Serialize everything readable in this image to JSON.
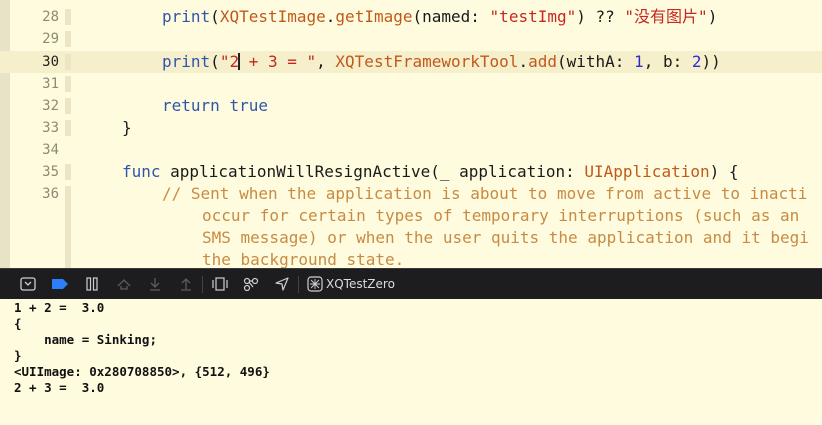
{
  "editor": {
    "lines": [
      {
        "num": "28"
      },
      {
        "num": "29"
      },
      {
        "num": "30"
      },
      {
        "num": "31"
      },
      {
        "num": "32"
      },
      {
        "num": "33"
      },
      {
        "num": "34"
      },
      {
        "num": "35"
      },
      {
        "num": "36"
      }
    ],
    "t": {
      "print": "print",
      "paren_open": "(",
      "xqtestimage": "XQTestImage",
      "dot": ".",
      "getimage": "getImage",
      "named_label": "(named: ",
      "test_img": "\"testImg\"",
      "coalesce": ") ?? ",
      "no_image": "\"没有图片\"",
      "paren_close": ")",
      "str_part1": "\"2",
      "str_part2": " + 3 = \"",
      "comma": ", ",
      "framework_tool": "XQTestFrameworkTool",
      "add": "add",
      "with_a": "(withA: ",
      "num_1": "1",
      "b_label": ", b: ",
      "num_2": "2",
      "close_two": "))",
      "return_kw": "return",
      "true_kw": "true",
      "brace_close": "}",
      "func_kw": "func",
      "func_name": " applicationWillResignActive(_ application: ",
      "uiapplication": "UIApplication",
      "func_tail": ") {",
      "comment_1": "// Sent when the application is about to move from active to inacti",
      "comment_2": "occur for certain types of temporary interruptions (such as an",
      "comment_3": "SMS message) or when the user quits the application and it begi",
      "comment_4": "the background state."
    }
  },
  "debug_bar": {
    "target": "XQTestZero"
  },
  "console": {
    "output": [
      "1 + 2 =  3.0",
      "{",
      "    name = Sinking;",
      "}",
      "<UIImage: 0x280708850>, {512, 496}",
      "2 + 3 =  3.0"
    ]
  },
  "colors": {
    "editor_bg": "#fffbdf",
    "current_line": "#f5efcb",
    "keyword": "#2f56a8",
    "identifier": "#c05a1b",
    "string": "#c4291f",
    "number": "#2e2ed0",
    "comment": "#c78b43",
    "debug_bar": "#1d1d1f",
    "active_icon": "#2d7ff9"
  }
}
